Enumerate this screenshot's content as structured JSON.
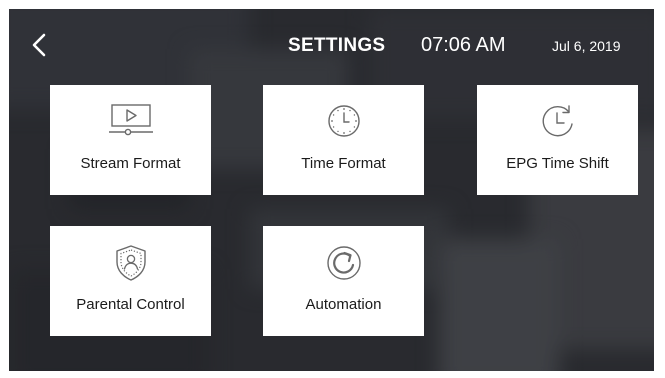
{
  "header": {
    "title": "SETTINGS",
    "time": "07:06 AM",
    "date": "Jul 6, 2019"
  },
  "tiles": [
    {
      "label": "Stream Format",
      "icon": "video-player-icon"
    },
    {
      "label": "Time Format",
      "icon": "clock-icon"
    },
    {
      "label": "EPG Time Shift",
      "icon": "time-shift-icon"
    },
    {
      "label": "Parental Control",
      "icon": "parental-shield-icon"
    },
    {
      "label": "Automation",
      "icon": "automation-refresh-icon"
    }
  ],
  "colors": {
    "tile_background": "#ffffff",
    "icon_stroke": "#6a6a6a",
    "header_text": "#ffffff"
  }
}
